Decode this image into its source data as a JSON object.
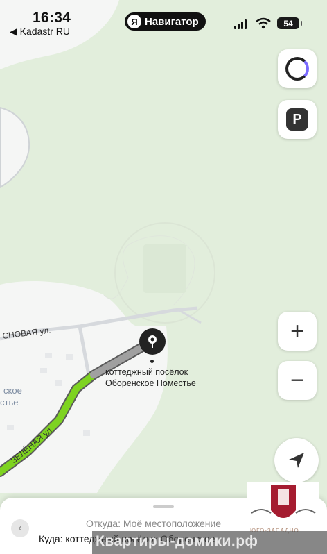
{
  "status_bar": {
    "time": "16:34",
    "back_app": "◀ Kadastr RU",
    "app_badge": "Навигатор",
    "battery": "54"
  },
  "map": {
    "street_1": "СНОВАЯ ул.",
    "street_2": "ЗЕЛЁНАЯ ул.",
    "destination_label_1": "коттеджный посёлок",
    "destination_label_2": "Оборенское Поместье",
    "place_label_1": "ское",
    "place_label_2": "стье",
    "route_color": "#7ed321",
    "road_color": "#ffffff",
    "forest_color": "#e2eedc"
  },
  "controls": {
    "alice_button": "alice-icon",
    "parking_button": "P",
    "zoom_in": "+",
    "zoom_out": "−",
    "locate": "navigation-arrow-icon"
  },
  "sheet": {
    "from": "Откуда: Моё местоположение",
    "to": "Куда: коттеджный посёлок Оборенское"
  },
  "watermark": {
    "text": "Квартиры-домики.рф",
    "sub": "ЮГО-ЗАПАДНО"
  }
}
